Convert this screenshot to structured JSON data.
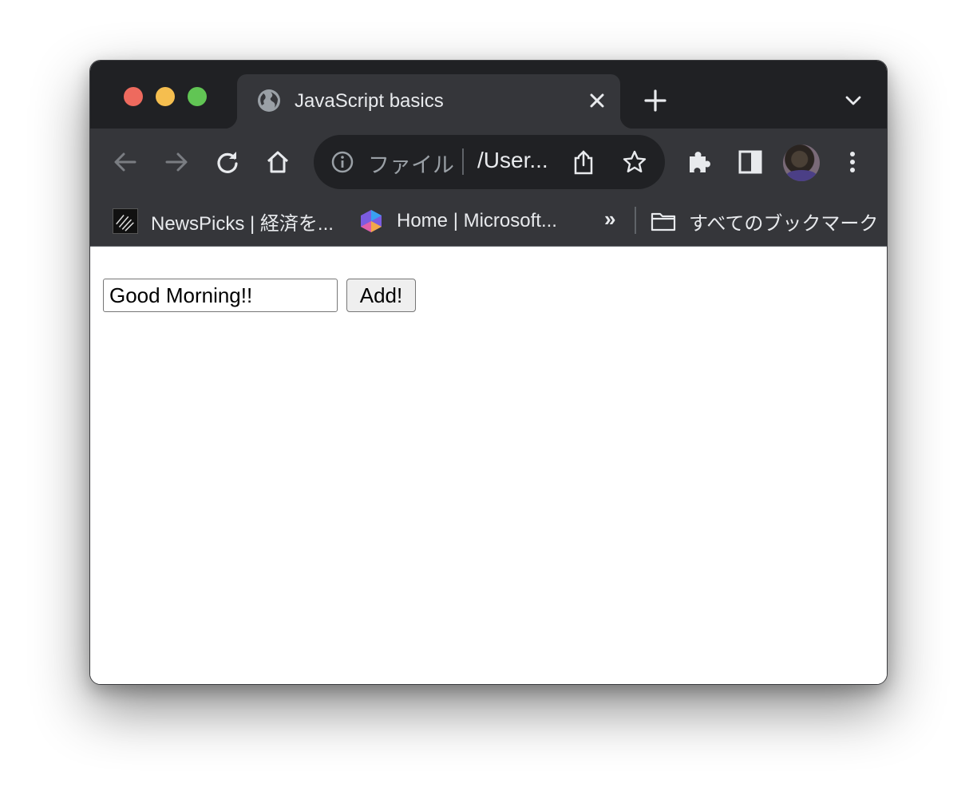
{
  "tab": {
    "title": "JavaScript basics"
  },
  "omnibox": {
    "scheme_label": "ファイル",
    "url": "/User..."
  },
  "bookmarks": [
    {
      "label": "NewsPicks | 経済を..."
    },
    {
      "label": "Home | Microsoft..."
    }
  ],
  "bookmarks_more": "»",
  "all_bookmarks": {
    "label": "すべてのブックマーク"
  },
  "page": {
    "input_value": "Good Morning!!",
    "add_button_label": "Add!"
  },
  "colors": {
    "frame": "#202124",
    "toolbar": "#35363a",
    "text": "#e8eaed"
  }
}
